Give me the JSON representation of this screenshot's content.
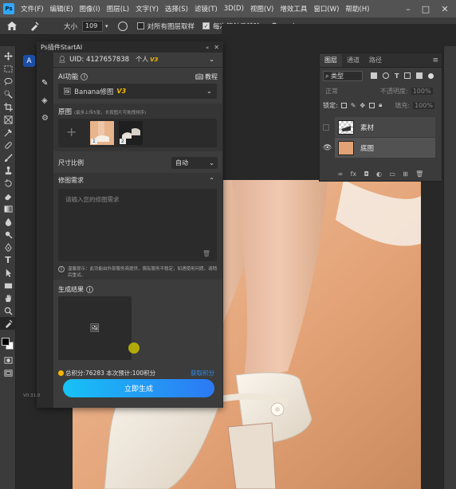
{
  "app": {
    "logo": "Ps"
  },
  "menu": [
    "文件(F)",
    "编辑(E)",
    "图像(I)",
    "图层(L)",
    "文字(Y)",
    "选择(S)",
    "滤镜(T)",
    "3D(D)",
    "视图(V)",
    "增效工具",
    "窗口(W)",
    "帮助(H)"
  ],
  "options_bar": {
    "size_label": "大小",
    "size_value": "109",
    "sample_all_label": "对所有图层取样",
    "erase_label": "每次笔触后移除"
  },
  "plugin": {
    "title": "Ps插件StartAI",
    "uid": "UID: 4127657838",
    "account_type": "个人",
    "account_badge": "V3",
    "ai_function_label": "AI功能",
    "tutorial_label": "教程",
    "model_name": "Banana修图",
    "model_badge": "V3",
    "original_label": "原图",
    "original_hint": "(最多上传5张，长按图片可拖拽排序)",
    "thumbnails": [
      {
        "index": "1"
      },
      {
        "index": "2"
      }
    ],
    "ratio_label": "尺寸比例",
    "ratio_value": "自动",
    "requirement_label": "修图需求",
    "requirement_placeholder": "请输入您的修图需求",
    "notice": "温馨提示：此功能由外部服务商提供，偶有服务不稳定，如遇使用问题，请稍后重试。",
    "result_label": "生成结果",
    "points_text": "总积分:76283  本次预计:100积分",
    "get_points_label": "获取积分",
    "generate_label": "立即生成",
    "version": "V0.31.0"
  },
  "layers_panel": {
    "tabs": [
      "图层",
      "通道",
      "路径"
    ],
    "kind_label": "类型",
    "blend_mode": "正常",
    "opacity_label": "不透明度:",
    "opacity_value": "100%",
    "lock_label": "锁定:",
    "fill_label": "填充:",
    "fill_value": "100%",
    "layers": [
      {
        "name": "素材",
        "visible": false
      },
      {
        "name": "底图",
        "visible": true
      }
    ]
  },
  "colors": {
    "accent": "#2d8cf0",
    "gold": "#f5b800",
    "ps_blue": "#31a8ff"
  }
}
